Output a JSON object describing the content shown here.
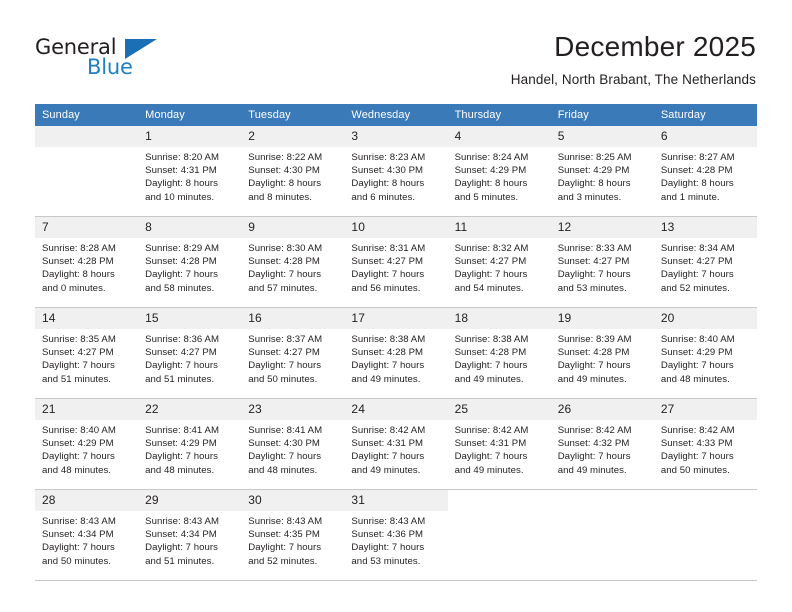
{
  "logo": {
    "word_one": "General",
    "word_two": "Blue",
    "triangle": "blue-triangle-icon"
  },
  "header": {
    "title": "December 2025",
    "subtitle": "Handel, North Brabant, The Netherlands"
  },
  "calendar": {
    "weekday_headers": [
      "Sunday",
      "Monday",
      "Tuesday",
      "Wednesday",
      "Thursday",
      "Friday",
      "Saturday"
    ],
    "colors": {
      "header_bg": "#3b7ab9",
      "header_text": "#ffffff",
      "daynum_bg": "#f0f0f0",
      "grid_line": "#c8c8c8",
      "text": "#231f20",
      "logo_blue": "#1f7fc4"
    },
    "weeks": [
      [
        {
          "day": "",
          "blank": true
        },
        {
          "day": "1",
          "sunrise": "Sunrise: 8:20 AM",
          "sunset": "Sunset: 4:31 PM",
          "daylight1": "Daylight: 8 hours",
          "daylight2": "and 10 minutes."
        },
        {
          "day": "2",
          "sunrise": "Sunrise: 8:22 AM",
          "sunset": "Sunset: 4:30 PM",
          "daylight1": "Daylight: 8 hours",
          "daylight2": "and 8 minutes."
        },
        {
          "day": "3",
          "sunrise": "Sunrise: 8:23 AM",
          "sunset": "Sunset: 4:30 PM",
          "daylight1": "Daylight: 8 hours",
          "daylight2": "and 6 minutes."
        },
        {
          "day": "4",
          "sunrise": "Sunrise: 8:24 AM",
          "sunset": "Sunset: 4:29 PM",
          "daylight1": "Daylight: 8 hours",
          "daylight2": "and 5 minutes."
        },
        {
          "day": "5",
          "sunrise": "Sunrise: 8:25 AM",
          "sunset": "Sunset: 4:29 PM",
          "daylight1": "Daylight: 8 hours",
          "daylight2": "and 3 minutes."
        },
        {
          "day": "6",
          "sunrise": "Sunrise: 8:27 AM",
          "sunset": "Sunset: 4:28 PM",
          "daylight1": "Daylight: 8 hours",
          "daylight2": "and 1 minute."
        }
      ],
      [
        {
          "day": "7",
          "sunrise": "Sunrise: 8:28 AM",
          "sunset": "Sunset: 4:28 PM",
          "daylight1": "Daylight: 8 hours",
          "daylight2": "and 0 minutes."
        },
        {
          "day": "8",
          "sunrise": "Sunrise: 8:29 AM",
          "sunset": "Sunset: 4:28 PM",
          "daylight1": "Daylight: 7 hours",
          "daylight2": "and 58 minutes."
        },
        {
          "day": "9",
          "sunrise": "Sunrise: 8:30 AM",
          "sunset": "Sunset: 4:28 PM",
          "daylight1": "Daylight: 7 hours",
          "daylight2": "and 57 minutes."
        },
        {
          "day": "10",
          "sunrise": "Sunrise: 8:31 AM",
          "sunset": "Sunset: 4:27 PM",
          "daylight1": "Daylight: 7 hours",
          "daylight2": "and 56 minutes."
        },
        {
          "day": "11",
          "sunrise": "Sunrise: 8:32 AM",
          "sunset": "Sunset: 4:27 PM",
          "daylight1": "Daylight: 7 hours",
          "daylight2": "and 54 minutes."
        },
        {
          "day": "12",
          "sunrise": "Sunrise: 8:33 AM",
          "sunset": "Sunset: 4:27 PM",
          "daylight1": "Daylight: 7 hours",
          "daylight2": "and 53 minutes."
        },
        {
          "day": "13",
          "sunrise": "Sunrise: 8:34 AM",
          "sunset": "Sunset: 4:27 PM",
          "daylight1": "Daylight: 7 hours",
          "daylight2": "and 52 minutes."
        }
      ],
      [
        {
          "day": "14",
          "sunrise": "Sunrise: 8:35 AM",
          "sunset": "Sunset: 4:27 PM",
          "daylight1": "Daylight: 7 hours",
          "daylight2": "and 51 minutes."
        },
        {
          "day": "15",
          "sunrise": "Sunrise: 8:36 AM",
          "sunset": "Sunset: 4:27 PM",
          "daylight1": "Daylight: 7 hours",
          "daylight2": "and 51 minutes."
        },
        {
          "day": "16",
          "sunrise": "Sunrise: 8:37 AM",
          "sunset": "Sunset: 4:27 PM",
          "daylight1": "Daylight: 7 hours",
          "daylight2": "and 50 minutes."
        },
        {
          "day": "17",
          "sunrise": "Sunrise: 8:38 AM",
          "sunset": "Sunset: 4:28 PM",
          "daylight1": "Daylight: 7 hours",
          "daylight2": "and 49 minutes."
        },
        {
          "day": "18",
          "sunrise": "Sunrise: 8:38 AM",
          "sunset": "Sunset: 4:28 PM",
          "daylight1": "Daylight: 7 hours",
          "daylight2": "and 49 minutes."
        },
        {
          "day": "19",
          "sunrise": "Sunrise: 8:39 AM",
          "sunset": "Sunset: 4:28 PM",
          "daylight1": "Daylight: 7 hours",
          "daylight2": "and 49 minutes."
        },
        {
          "day": "20",
          "sunrise": "Sunrise: 8:40 AM",
          "sunset": "Sunset: 4:29 PM",
          "daylight1": "Daylight: 7 hours",
          "daylight2": "and 48 minutes."
        }
      ],
      [
        {
          "day": "21",
          "sunrise": "Sunrise: 8:40 AM",
          "sunset": "Sunset: 4:29 PM",
          "daylight1": "Daylight: 7 hours",
          "daylight2": "and 48 minutes."
        },
        {
          "day": "22",
          "sunrise": "Sunrise: 8:41 AM",
          "sunset": "Sunset: 4:29 PM",
          "daylight1": "Daylight: 7 hours",
          "daylight2": "and 48 minutes."
        },
        {
          "day": "23",
          "sunrise": "Sunrise: 8:41 AM",
          "sunset": "Sunset: 4:30 PM",
          "daylight1": "Daylight: 7 hours",
          "daylight2": "and 48 minutes."
        },
        {
          "day": "24",
          "sunrise": "Sunrise: 8:42 AM",
          "sunset": "Sunset: 4:31 PM",
          "daylight1": "Daylight: 7 hours",
          "daylight2": "and 49 minutes."
        },
        {
          "day": "25",
          "sunrise": "Sunrise: 8:42 AM",
          "sunset": "Sunset: 4:31 PM",
          "daylight1": "Daylight: 7 hours",
          "daylight2": "and 49 minutes."
        },
        {
          "day": "26",
          "sunrise": "Sunrise: 8:42 AM",
          "sunset": "Sunset: 4:32 PM",
          "daylight1": "Daylight: 7 hours",
          "daylight2": "and 49 minutes."
        },
        {
          "day": "27",
          "sunrise": "Sunrise: 8:42 AM",
          "sunset": "Sunset: 4:33 PM",
          "daylight1": "Daylight: 7 hours",
          "daylight2": "and 50 minutes."
        }
      ],
      [
        {
          "day": "28",
          "sunrise": "Sunrise: 8:43 AM",
          "sunset": "Sunset: 4:34 PM",
          "daylight1": "Daylight: 7 hours",
          "daylight2": "and 50 minutes."
        },
        {
          "day": "29",
          "sunrise": "Sunrise: 8:43 AM",
          "sunset": "Sunset: 4:34 PM",
          "daylight1": "Daylight: 7 hours",
          "daylight2": "and 51 minutes."
        },
        {
          "day": "30",
          "sunrise": "Sunrise: 8:43 AM",
          "sunset": "Sunset: 4:35 PM",
          "daylight1": "Daylight: 7 hours",
          "daylight2": "and 52 minutes."
        },
        {
          "day": "31",
          "sunrise": "Sunrise: 8:43 AM",
          "sunset": "Sunset: 4:36 PM",
          "daylight1": "Daylight: 7 hours",
          "daylight2": "and 53 minutes."
        },
        {
          "day": "",
          "empty": true
        },
        {
          "day": "",
          "empty": true
        },
        {
          "day": "",
          "empty": true
        }
      ]
    ]
  }
}
